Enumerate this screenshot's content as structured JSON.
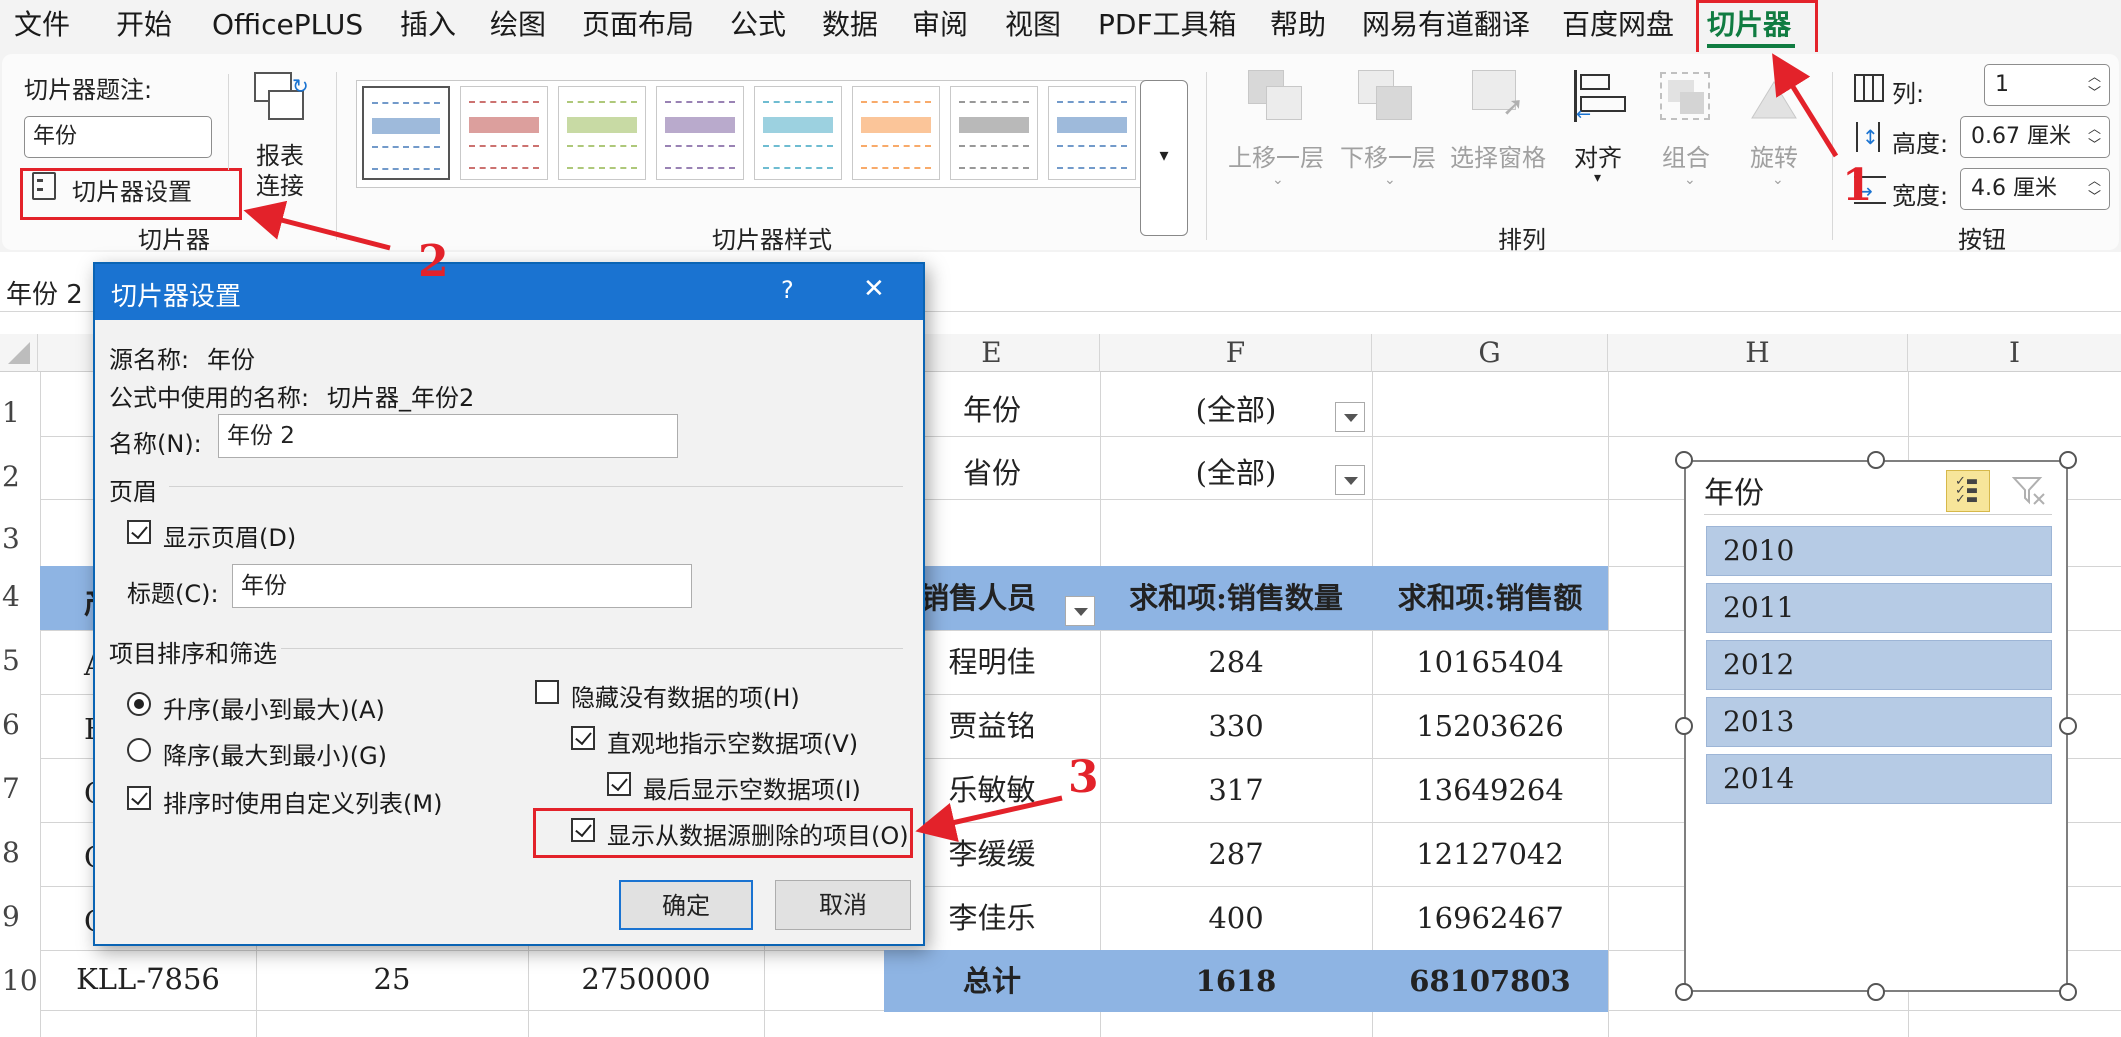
{
  "menu": [
    "文件",
    "开始",
    "OfficePLUS",
    "插入",
    "绘图",
    "页面布局",
    "公式",
    "数据",
    "审阅",
    "视图",
    "PDF工具箱",
    "帮助",
    "网易有道翻译",
    "百度网盘",
    "切片器"
  ],
  "ribbon": {
    "caption_label": "切片器题注:",
    "caption_value": "年份",
    "settings_button": "切片器设置",
    "report_connect": [
      "报表",
      "连接"
    ],
    "group_slicer": "切片器",
    "group_styles": "切片器样式",
    "group_arrange": "排列",
    "group_buttons": "按钮",
    "arrange": {
      "bring_forward": "上移一层",
      "send_backward": "下移一层",
      "selection_pane": "选择窗格",
      "align": "对齐",
      "group": "组合",
      "rotate": "旋转"
    },
    "columns_label": "列:",
    "columns_value": "1",
    "height_label": "高度:",
    "height_value": "0.67 厘米",
    "width_label": "宽度:",
    "width_value": "4.6 厘米",
    "style_colors": [
      "#4f81bd",
      "#c0504d",
      "#9bbb59",
      "#8064a2",
      "#4bacc6",
      "#f79646",
      "#7f7f7f",
      "#4f81bd"
    ]
  },
  "namebox": "年份 2",
  "columns": [
    "E",
    "F",
    "G",
    "H",
    "I"
  ],
  "rows": [
    "1",
    "2",
    "3",
    "4",
    "5",
    "6",
    "7",
    "8",
    "9",
    "10"
  ],
  "filters": [
    {
      "label": "年份",
      "value": "(全部)"
    },
    {
      "label": "省份",
      "value": "(全部)"
    }
  ],
  "pivot": {
    "headers": [
      "销售人员",
      "求和项:销售数量",
      "求和项:销售额"
    ],
    "rows": [
      [
        "程明佳",
        "284",
        "10165404"
      ],
      [
        "贾益铭",
        "330",
        "15203626"
      ],
      [
        "乐敏敏",
        "317",
        "13649264"
      ],
      [
        "李缓缓",
        "287",
        "12127042"
      ],
      [
        "李佳乐",
        "400",
        "16962467"
      ]
    ],
    "total": [
      "总计",
      "1618",
      "68107803"
    ]
  },
  "left_table": {
    "partial_cells": [
      "产",
      "A",
      "B",
      "C",
      "C",
      "C"
    ],
    "row10": [
      "KLL-7856",
      "25",
      "2750000"
    ]
  },
  "dialog": {
    "title": "切片器设置",
    "help": "?",
    "close": "✕",
    "source_name_label": "源名称:",
    "source_name": "年份",
    "formula_name_label": "公式中使用的名称:",
    "formula_name": "切片器_年份2",
    "name_label": "名称(N):",
    "name_value": "年份 2",
    "header_section": "页眉",
    "show_header": "显示页眉(D)",
    "caption_label": "标题(C):",
    "caption_value": "年份",
    "sort_section": "项目排序和筛选",
    "asc": "升序(最小到最大)(A)",
    "desc": "降序(最大到最小)(G)",
    "custom_list": "排序时使用自定义列表(M)",
    "hide_no_data": "隐藏没有数据的项(H)",
    "visual_empty": "直观地指示空数据项(V)",
    "show_empty_last": "最后显示空数据项(I)",
    "show_deleted": "显示从数据源删除的项目(O)",
    "ok": "确定",
    "cancel": "取消"
  },
  "slicer": {
    "title": "年份",
    "items": [
      "2010",
      "2011",
      "2012",
      "2013",
      "2014"
    ]
  },
  "annotations": [
    "1",
    "2",
    "3"
  ]
}
